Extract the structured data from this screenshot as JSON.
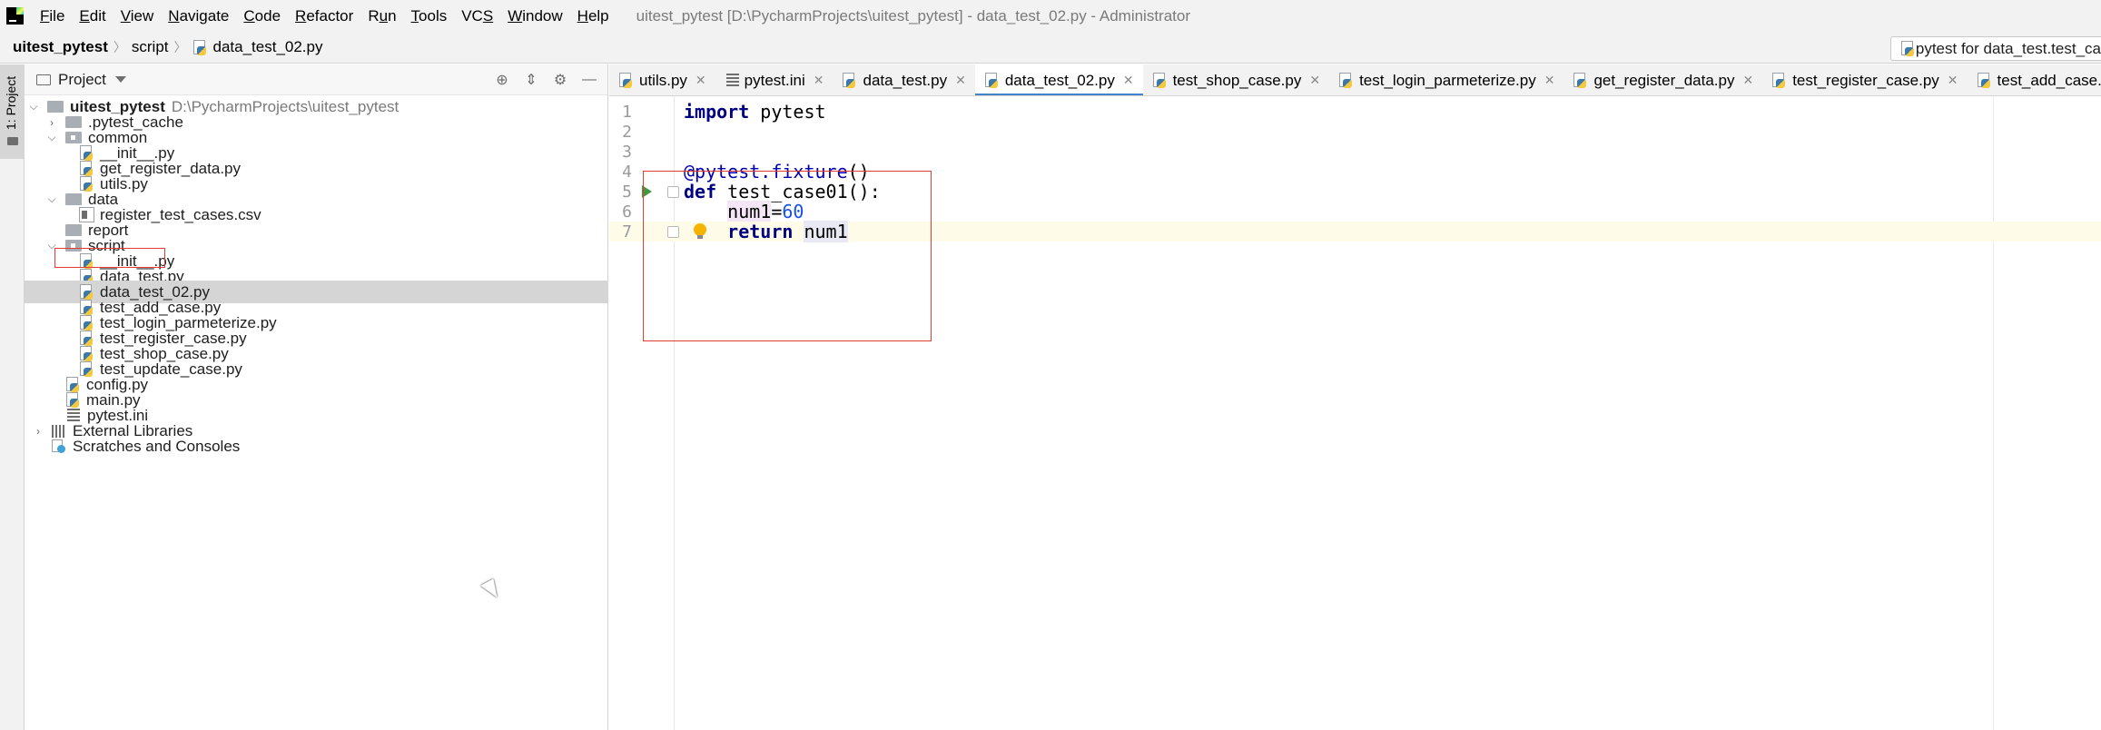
{
  "menu": {
    "items": [
      {
        "label": "File",
        "u": "F"
      },
      {
        "label": "Edit",
        "u": "E"
      },
      {
        "label": "View",
        "u": "V"
      },
      {
        "label": "Navigate",
        "u": "N"
      },
      {
        "label": "Code",
        "u": "C"
      },
      {
        "label": "Refactor",
        "u": "R"
      },
      {
        "label": "Run",
        "u": "u"
      },
      {
        "label": "Tools",
        "u": "T"
      },
      {
        "label": "VCS",
        "u": "S"
      },
      {
        "label": "Window",
        "u": "W"
      },
      {
        "label": "Help",
        "u": "H"
      }
    ],
    "window_title": "uitest_pytest [D:\\PycharmProjects\\uitest_pytest] - data_test_02.py - Administrator"
  },
  "breadcrumb": {
    "project": "uitest_pytest",
    "folder": "script",
    "file": "data_test_02.py"
  },
  "run_config": {
    "label": "pytest for data_test.test_ca"
  },
  "toolstrip": {
    "project_label": "1: Project"
  },
  "project_panel": {
    "title": "Project",
    "root_name": "uitest_pytest",
    "root_path": "D:\\PycharmProjects\\uitest_pytest",
    "tree": [
      {
        "label": ".pytest_cache",
        "type": "folder"
      },
      {
        "label": "common",
        "type": "folder-mod"
      },
      {
        "label": "__init__.py",
        "type": "py"
      },
      {
        "label": "get_register_data.py",
        "type": "py"
      },
      {
        "label": "utils.py",
        "type": "py"
      },
      {
        "label": "data",
        "type": "folder"
      },
      {
        "label": "register_test_cases.csv",
        "type": "csv"
      },
      {
        "label": "report",
        "type": "folder"
      },
      {
        "label": "script",
        "type": "folder-mod"
      },
      {
        "label": "__init__.py",
        "type": "py"
      },
      {
        "label": "data_test.py",
        "type": "py"
      },
      {
        "label": "data_test_02.py",
        "type": "py"
      },
      {
        "label": "test_add_case.py",
        "type": "py"
      },
      {
        "label": "test_login_parmeterize.py",
        "type": "py"
      },
      {
        "label": "test_register_case.py",
        "type": "py"
      },
      {
        "label": "test_shop_case.py",
        "type": "py"
      },
      {
        "label": "test_update_case.py",
        "type": "py"
      },
      {
        "label": "config.py",
        "type": "py"
      },
      {
        "label": "main.py",
        "type": "py"
      },
      {
        "label": "pytest.ini",
        "type": "ini"
      },
      {
        "label": "External Libraries",
        "type": "lib"
      },
      {
        "label": "Scratches and Consoles",
        "type": "scratch"
      }
    ]
  },
  "tabs": [
    {
      "label": "utils.py",
      "type": "py"
    },
    {
      "label": "pytest.ini",
      "type": "ini"
    },
    {
      "label": "data_test.py",
      "type": "py"
    },
    {
      "label": "data_test_02.py",
      "type": "py",
      "active": true
    },
    {
      "label": "test_shop_case.py",
      "type": "py"
    },
    {
      "label": "test_login_parmeterize.py",
      "type": "py"
    },
    {
      "label": "get_register_data.py",
      "type": "py"
    },
    {
      "label": "test_register_case.py",
      "type": "py"
    },
    {
      "label": "test_add_case.py",
      "type": "py"
    }
  ],
  "editor": {
    "lines": [
      {
        "n": "1",
        "segments": [
          {
            "t": "import",
            "c": "kw"
          },
          {
            "t": " pytest",
            "c": ""
          }
        ]
      },
      {
        "n": "2",
        "segments": []
      },
      {
        "n": "3",
        "segments": []
      },
      {
        "n": "4",
        "segments": [
          {
            "t": "@pytest.fixture",
            "c": "deco"
          },
          {
            "t": "()",
            "c": ""
          }
        ]
      },
      {
        "n": "5",
        "segments": [
          {
            "t": "def",
            "c": "kw"
          },
          {
            "t": " test_case01():",
            "c": ""
          }
        ]
      },
      {
        "n": "6",
        "segments": [
          {
            "t": "    ",
            "c": ""
          },
          {
            "t": "num1",
            "c": "lvar"
          },
          {
            "t": "=",
            "c": ""
          },
          {
            "t": "60",
            "c": "num"
          }
        ]
      },
      {
        "n": "7",
        "segments": [
          {
            "t": "    ",
            "c": ""
          },
          {
            "t": "return",
            "c": "kw"
          },
          {
            "t": " ",
            "c": ""
          },
          {
            "t": "num1",
            "c": "ref"
          }
        ]
      }
    ]
  }
}
